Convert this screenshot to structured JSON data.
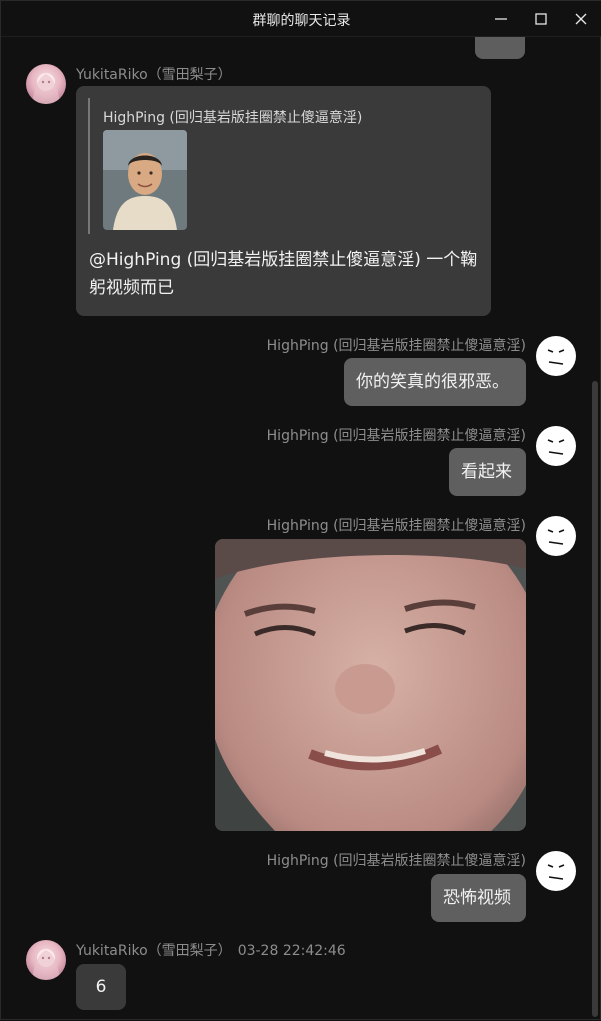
{
  "window": {
    "title": "群聊的聊天记录"
  },
  "messages": [
    {
      "sender": "YukitaRiko（雪田梨子）",
      "quote": {
        "sender": "HighPing (回归基岩版挂圈禁止傻逼意淫)"
      },
      "text": "@HighPing (回归基岩版挂圈禁止傻逼意淫) 一个鞠躬视频而已"
    },
    {
      "sender": "HighPing (回归基岩版挂圈禁止傻逼意淫)",
      "text": "你的笑真的很邪恶。"
    },
    {
      "sender": "HighPing (回归基岩版挂圈禁止傻逼意淫)",
      "text": "看起来"
    },
    {
      "sender": "HighPing (回归基岩版挂圈禁止傻逼意淫)",
      "image": "photo"
    },
    {
      "sender": "HighPing (回归基岩版挂圈禁止傻逼意淫)",
      "text": "恐怖视频"
    },
    {
      "sender": "YukitaRiko（雪田梨子）",
      "time": "03-28 22:42:46",
      "text": "6"
    }
  ],
  "colors": {
    "background": "#111111",
    "bubble_incoming": "#3a3a3a",
    "bubble_outgoing": "#5f5f5f",
    "name": "#8d8d8d"
  },
  "icons": [
    "minimize-icon",
    "maximize-icon",
    "close-icon",
    "face-avatar-icon"
  ]
}
